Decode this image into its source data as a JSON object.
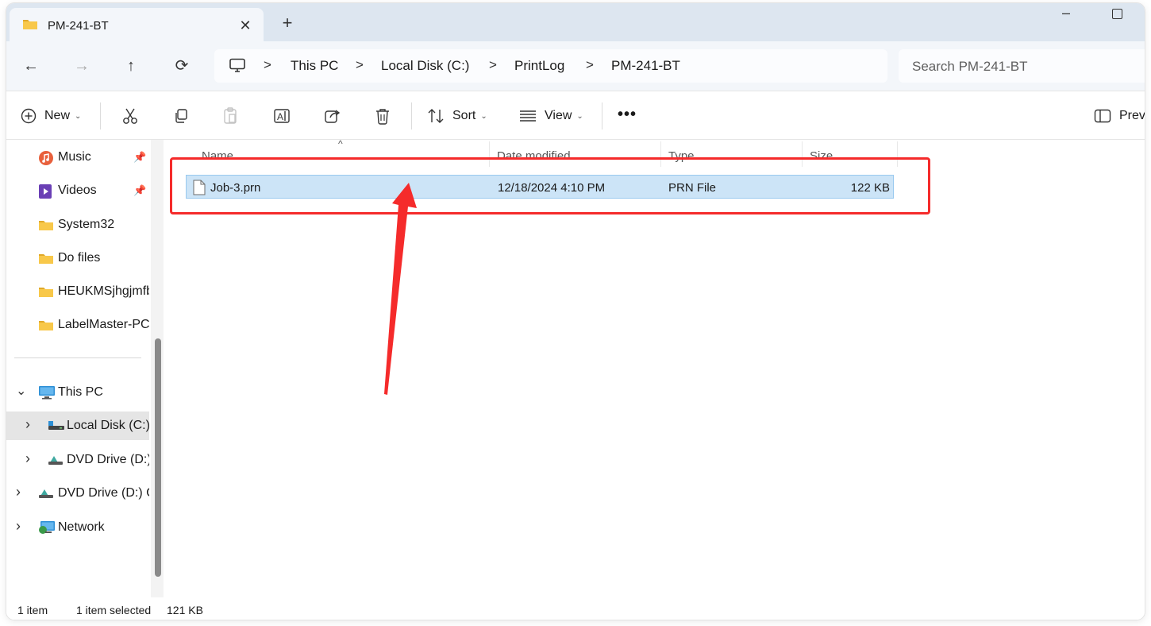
{
  "tab": {
    "title": "PM-241-BT",
    "close": "✕",
    "new_tab": "+"
  },
  "window_controls": {
    "minimize": "–"
  },
  "nav": {
    "back": "←",
    "forward": "→",
    "up": "↑",
    "refresh": "⟳"
  },
  "breadcrumb": [
    "This PC",
    "Local Disk (C:)",
    "PrintLog",
    "PM-241-BT"
  ],
  "breadcrumb_sep": ">",
  "search": {
    "placeholder": "Search PM-241-BT"
  },
  "toolbar": {
    "new_label": "New",
    "sort_label": "Sort",
    "view_label": "View",
    "more": "•••",
    "preview_label": "Previ",
    "caret": "⌄"
  },
  "sidebar": {
    "pinned": [
      {
        "label": "Music",
        "icon": "music-icon",
        "pinned": true
      },
      {
        "label": "Videos",
        "icon": "videos-icon",
        "pinned": true
      },
      {
        "label": "System32",
        "icon": "folder-icon"
      },
      {
        "label": "Do files",
        "icon": "folder-icon"
      },
      {
        "label": "HEUKMSjhgjmfb",
        "icon": "folder-icon"
      },
      {
        "label": "LabelMaster-PC",
        "icon": "folder-icon"
      }
    ],
    "tree": [
      {
        "label": "This PC",
        "icon": "pc-icon",
        "expanded": true
      },
      {
        "label": "Local Disk (C:)",
        "icon": "drive-icon",
        "selected": true
      },
      {
        "label": "DVD Drive (D:)",
        "icon": "dvd-icon"
      },
      {
        "label": "DVD Drive (D:) C",
        "icon": "dvd-icon"
      },
      {
        "label": "Network",
        "icon": "network-icon"
      }
    ],
    "chevron_down": "⌄",
    "chevron_right": "›"
  },
  "columns": {
    "name": "Name",
    "date": "Date modified",
    "type": "Type",
    "size": "Size",
    "sort_indicator": "^"
  },
  "files": [
    {
      "name": "Job-3.prn",
      "date": "12/18/2024 4:10 PM",
      "type": "PRN File",
      "size": "122 KB",
      "selected": true
    }
  ],
  "status": {
    "count": "1 item",
    "selected": "1 item selected",
    "size": "121 KB"
  },
  "colors": {
    "accent_red": "#f52b2b",
    "selection": "#cce4f7",
    "folder": "#f8c84a"
  }
}
